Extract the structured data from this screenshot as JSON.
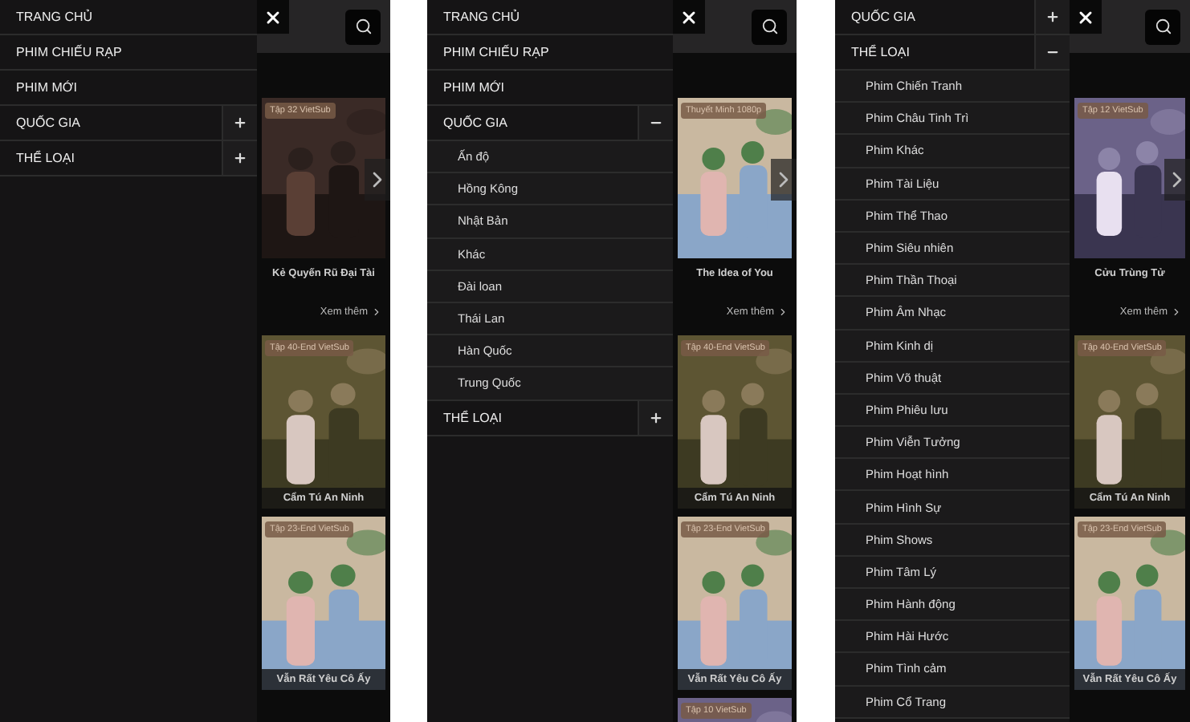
{
  "panels": [
    {
      "menu": {
        "items": [
          {
            "label": "TRANG CHỦ"
          },
          {
            "label": "PHIM CHIẾU RẠP"
          },
          {
            "label": "PHIM MỚI"
          },
          {
            "label": "QUỐC GIA",
            "expanded": false
          },
          {
            "label": "THỂ LOẠI",
            "expanded": false
          }
        ]
      },
      "featured": {
        "badge": "Tập 32 VietSub",
        "title": "Kẻ Quyến Rũ Đại Tài"
      },
      "more_link": "Xem thêm",
      "cards": [
        {
          "badge": "Tập 40-End VietSub",
          "title": "Cẩm Tú An Ninh"
        },
        {
          "badge": "Tập 23-End VietSub",
          "title": "Vẫn Rất Yêu Cô Ấy"
        }
      ]
    },
    {
      "menu": {
        "items": [
          {
            "label": "TRANG CHỦ"
          },
          {
            "label": "PHIM CHIẾU RẠP"
          },
          {
            "label": "PHIM MỚI"
          },
          {
            "label": "QUỐC GIA",
            "expanded": true,
            "children": [
              "Ấn độ",
              "Hồng Kông",
              "Nhật Bản",
              "Khác",
              "Đài loan",
              "Thái Lan",
              "Hàn Quốc",
              "Trung Quốc"
            ]
          },
          {
            "label": "THỂ LOẠI",
            "expanded": false
          }
        ]
      },
      "featured": {
        "badge": "Thuyết Minh 1080p",
        "title": "The Idea of You"
      },
      "more_link": "Xem thêm",
      "cards": [
        {
          "badge": "Tập 40-End VietSub",
          "title": "Cẩm Tú An Ninh"
        },
        {
          "badge": "Tập 23-End VietSub",
          "title": "Vẫn Rất Yêu Cô Ấy"
        },
        {
          "badge": "Tập 10 VietSub"
        }
      ]
    },
    {
      "menu": {
        "items": [
          {
            "label": "QUỐC GIA",
            "expanded": false
          },
          {
            "label": "THỂ LOẠI",
            "expanded": true,
            "children": [
              "Phim Chiến Tranh",
              "Phim Châu Tinh Trì",
              "Phim Khác",
              "Phim Tài Liệu",
              "Phim Thể Thao",
              "Phim Siêu nhiên",
              "Phim Thần Thoại",
              "Phim Âm Nhạc",
              "Phim Kinh dị",
              "Phim Võ thuật",
              "Phim Phiêu lưu",
              "Phim Viễn Tưởng",
              "Phim Hoạt hình",
              "Phim Hình Sự",
              "Phim Shows",
              "Phim Tâm Lý",
              "Phim Hành động",
              "Phim Hài Hước",
              "Phim Tình cảm",
              "Phim Cổ Trang"
            ]
          }
        ]
      },
      "featured": {
        "badge": "Tập 12 VietSub",
        "title": "Cửu Trùng Tử"
      },
      "more_link": "Xem thêm",
      "cards": [
        {
          "badge": "Tập 40-End VietSub",
          "title": "Cẩm Tú An Ninh"
        },
        {
          "badge": "Tập 23-End VietSub",
          "title": "Vẫn Rất Yêu Cô Ấy"
        }
      ]
    }
  ]
}
